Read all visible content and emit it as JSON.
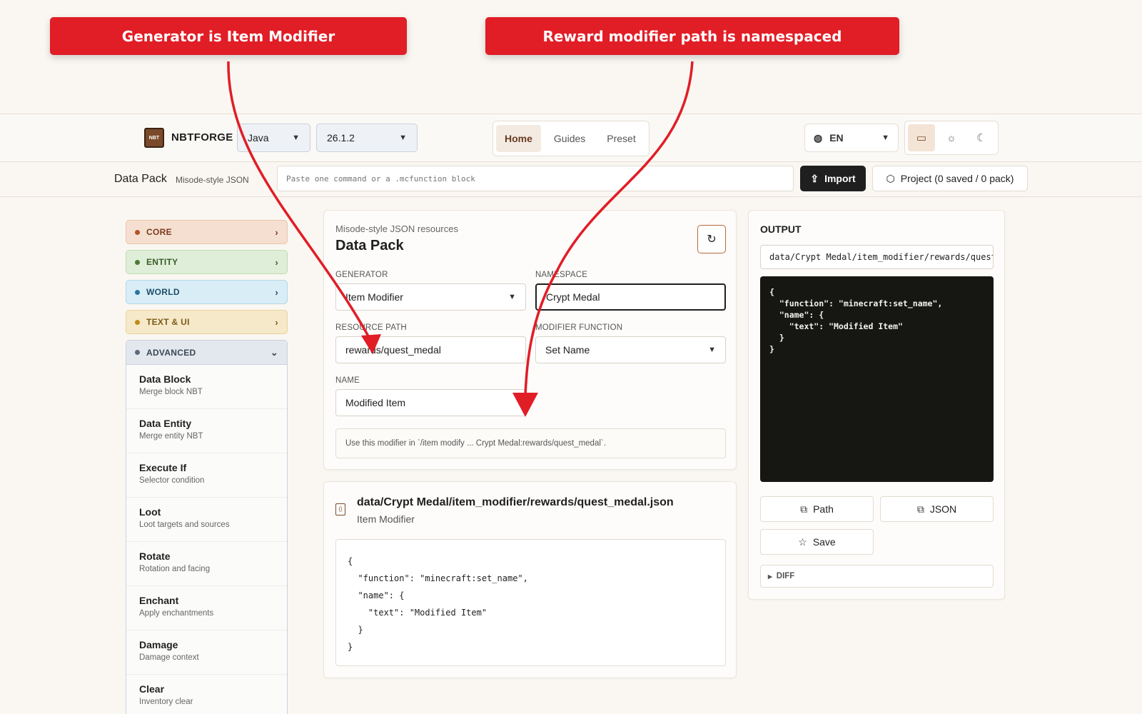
{
  "annotations": [
    {
      "text": "Generator is Item Modifier"
    },
    {
      "text": "Reward modifier path is namespaced"
    }
  ],
  "header": {
    "brand": "NBTFORGE",
    "logo_text": "NBT",
    "edition": "Java",
    "version": "26.1.2",
    "nav": [
      "Home",
      "Guides",
      "Preset"
    ],
    "active_nav": "Home",
    "language": "EN",
    "theme_modes": [
      "desktop-icon",
      "sun-icon",
      "moon-icon"
    ]
  },
  "subbar": {
    "title": "Data Pack",
    "subtitle": "Misode-style JSON",
    "command_placeholder": "Paste one command or a .mcfunction block",
    "import_label": "Import",
    "project_label": "Project (0 saved / 0 pack)"
  },
  "sidebar": {
    "categories": [
      "CORE",
      "ENTITY",
      "WORLD",
      "TEXT & UI"
    ],
    "advanced_label": "ADVANCED",
    "advanced_items": [
      {
        "title": "Data Block",
        "desc": "Merge block NBT"
      },
      {
        "title": "Data Entity",
        "desc": "Merge entity NBT"
      },
      {
        "title": "Execute If",
        "desc": "Selector condition"
      },
      {
        "title": "Loot",
        "desc": "Loot targets and sources"
      },
      {
        "title": "Rotate",
        "desc": "Rotation and facing"
      },
      {
        "title": "Enchant",
        "desc": "Apply enchantments"
      },
      {
        "title": "Damage",
        "desc": "Damage context"
      },
      {
        "title": "Clear",
        "desc": "Inventory clear"
      }
    ]
  },
  "editor": {
    "eyebrow": "Misode-style JSON resources",
    "title": "Data Pack",
    "generator_label": "GENERATOR",
    "generator_value": "Item Modifier",
    "namespace_label": "NAMESPACE",
    "namespace_value": "Crypt Medal",
    "resource_path_label": "RESOURCE PATH",
    "resource_path_value": "rewards/quest_medal",
    "modifier_function_label": "MODIFIER FUNCTION",
    "modifier_function_value": "Set Name",
    "name_label": "NAME",
    "name_value": "Modified Item",
    "hint": "Use this modifier in `/item modify ... Crypt Medal:rewards/quest_medal`."
  },
  "file": {
    "path": "data/Crypt Medal/item_modifier/rewards/quest_medal.json",
    "kind": "Item Modifier",
    "code": "{\n  \"function\": \"minecraft:set_name\",\n  \"name\": {\n    \"text\": \"Modified Item\"\n  }\n}"
  },
  "output": {
    "title": "OUTPUT",
    "path": "data/Crypt Medal/item_modifier/rewards/quest_medal.json",
    "code": "{\n  \"function\": \"minecraft:set_name\",\n  \"name\": {\n    \"text\": \"Modified Item\"\n  }\n}",
    "copy_path_label": "Path",
    "copy_json_label": "JSON",
    "save_label": "Save",
    "diff_label": "DIFF"
  },
  "colors": {
    "annotation_red": "#e11d26",
    "accent_brown": "#7a4a2a",
    "code_bg": "#161712"
  }
}
